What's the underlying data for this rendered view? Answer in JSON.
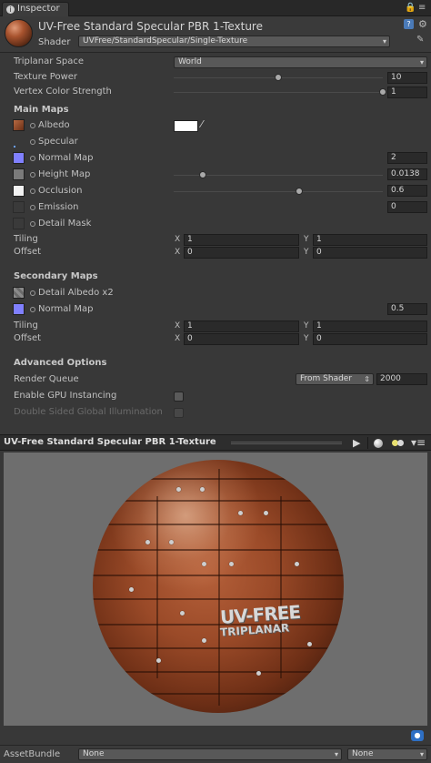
{
  "window": {
    "tab_label": "Inspector"
  },
  "header": {
    "material_title": "UV-Free Standard Specular PBR 1-Texture",
    "shader_label": "Shader",
    "shader_value": "UVFree/StandardSpecular/Single-Texture"
  },
  "properties": {
    "triplanar_space_label": "Triplanar Space",
    "triplanar_space_value": "World",
    "texture_power_label": "Texture Power",
    "texture_power_value": "10",
    "texture_power_fraction": 0.5,
    "vertex_color_label": "Vertex Color Strength",
    "vertex_color_value": "1",
    "vertex_color_fraction": 1.0
  },
  "main_maps": {
    "heading": "Main Maps",
    "albedo_label": "Albedo",
    "specular_label": "Specular",
    "normal_map_label": "Normal Map",
    "normal_map_value": "2",
    "height_map_label": "Height Map",
    "height_map_value": "0.0138",
    "height_map_fraction": 0.138,
    "occlusion_label": "Occlusion",
    "occlusion_value": "0.6",
    "occlusion_fraction": 0.6,
    "emission_label": "Emission",
    "emission_value": "0",
    "detail_mask_label": "Detail Mask",
    "tiling_label": "Tiling",
    "tiling_x": "1",
    "tiling_y": "1",
    "offset_label": "Offset",
    "offset_x": "0",
    "offset_y": "0"
  },
  "secondary_maps": {
    "heading": "Secondary Maps",
    "detail_albedo_label": "Detail Albedo x2",
    "normal_map_label": "Normal Map",
    "normal_map_value": "0.5",
    "tiling_label": "Tiling",
    "tiling_x": "1",
    "tiling_y": "1",
    "offset_label": "Offset",
    "offset_x": "0",
    "offset_y": "0"
  },
  "advanced": {
    "heading": "Advanced Options",
    "render_queue_label": "Render Queue",
    "render_queue_mode": "From Shader",
    "render_queue_value": "2000",
    "gpu_instancing_label": "Enable GPU Instancing",
    "double_sided_gi_label": "Double Sided Global Illumination"
  },
  "xy_labels": {
    "x": "X",
    "y": "Y"
  },
  "preview": {
    "title": "UV-Free Standard Specular PBR 1-Texture",
    "overlay_line1": "UV-FREE",
    "overlay_line2": "TRIPLANAR"
  },
  "asset_bundle": {
    "label": "AssetBundle",
    "name_value": "None",
    "variant_value": "None"
  },
  "colors": {
    "panel_bg": "#383838",
    "normal_map_swatch": "#8080ff",
    "albedo_color": "#ffffff",
    "wood_accent": "#9a4a28"
  }
}
